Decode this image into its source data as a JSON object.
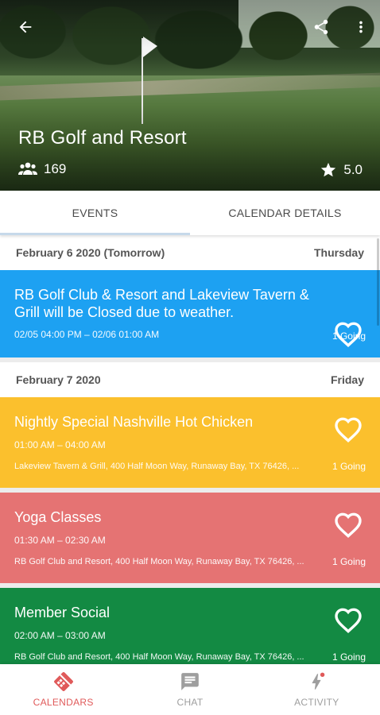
{
  "header": {
    "title": "RB Golf and Resort",
    "members_count": "169",
    "rating": "5.0"
  },
  "tabs": [
    {
      "label": "EVENTS",
      "active": true
    },
    {
      "label": "CALENDAR DETAILS",
      "active": false
    }
  ],
  "days": [
    {
      "date": "February 6 2020 (Tomorrow)",
      "weekday": "Thursday",
      "events": [
        {
          "title": "RB Golf Club & Resort and Lakeview Tavern & Grill will be Closed due to weather.",
          "time": "02/05 04:00 PM – 02/06 01:00 AM",
          "location": "",
          "going": "1 Going",
          "color": "#1da1f2"
        }
      ]
    },
    {
      "date": "February 7 2020",
      "weekday": "Friday",
      "events": [
        {
          "title": "Nightly Special Nashville Hot Chicken",
          "time": "01:00 AM – 04:00 AM",
          "location": "Lakeview Tavern & Grill, 400 Half Moon Way, Runaway Bay, TX 76426, ...",
          "going": "1 Going",
          "color": "#fbc02d"
        },
        {
          "title": "Yoga Classes",
          "time": "01:30 AM – 02:30 AM",
          "location": "RB Golf Club and Resort, 400 Half Moon Way, Runaway Bay, TX 76426, ...",
          "going": "1 Going",
          "color": "#e57373"
        },
        {
          "title": "Member Social",
          "time": "02:00 AM – 03:00 AM",
          "location": "RB Golf Club and Resort, 400 Half Moon Way, Runaway Bay, TX 76426, ...",
          "going": "1 Going",
          "color": "#138a43"
        }
      ]
    }
  ],
  "bottom_nav": [
    {
      "label": "CALENDARS",
      "icon": "calendars-icon",
      "active": true
    },
    {
      "label": "CHAT",
      "icon": "chat-icon",
      "active": false
    },
    {
      "label": "ACTIVITY",
      "icon": "activity-icon",
      "active": false
    }
  ],
  "colors": {
    "accent_active": "#e05a5a",
    "inactive": "#9e9e9e",
    "tab_indicator": "#c6d9ea"
  }
}
